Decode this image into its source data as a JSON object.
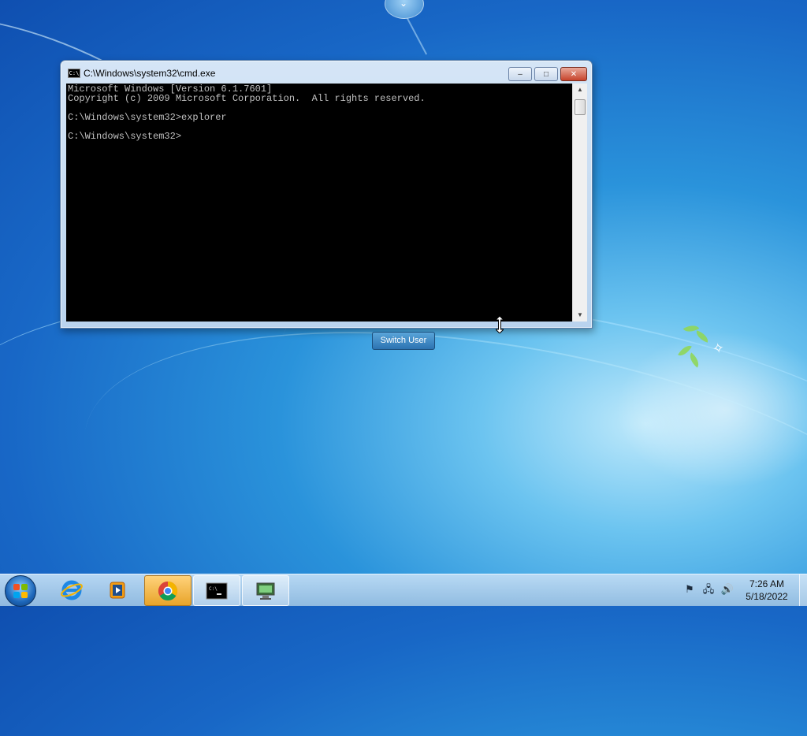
{
  "window": {
    "title": "C:\\Windows\\system32\\cmd.exe",
    "icon_text": "C:\\",
    "minimize_glyph": "–",
    "maximize_glyph": "□",
    "close_glyph": "✕"
  },
  "console": {
    "lines": [
      "Microsoft Windows [Version 6.1.7601]",
      "Copyright (c) 2009 Microsoft Corporation.  All rights reserved.",
      "",
      "C:\\Windows\\system32>explorer",
      "",
      "C:\\Windows\\system32>"
    ]
  },
  "login": {
    "switch_user_label": "Switch User"
  },
  "taskbar": {
    "buttons": [
      {
        "name": "Internet Explorer",
        "icon": "ie-icon"
      },
      {
        "name": "Windows Media Player",
        "icon": "media-player-icon"
      },
      {
        "name": "Google Chrome",
        "icon": "chrome-icon"
      },
      {
        "name": "cmd.exe",
        "icon": "cmd-icon"
      },
      {
        "name": "Remote app",
        "icon": "computer-icon"
      }
    ],
    "tray": {
      "action_center_icon": "flag-alert-icon",
      "network_icon": "network-icon",
      "volume_icon": "volume-icon"
    },
    "clock": {
      "time": "7:26 AM",
      "date": "5/18/2022"
    }
  },
  "colors": {
    "console_bg": "#000000",
    "console_fg": "#c0c0c0",
    "taskbar_accent": "#e8a42a"
  }
}
